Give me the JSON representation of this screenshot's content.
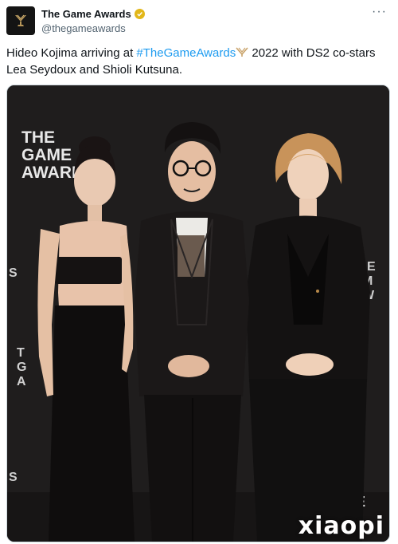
{
  "account": {
    "display_name": "The Game Awards",
    "handle": "@thegameawards",
    "avatar_icon": "trophy-logo-icon",
    "verified_color": "#e2b719"
  },
  "tweet": {
    "text_before": "Hideo Kojima arriving at ",
    "hashtag": "#TheGameAwards",
    "text_after": " 2022 with DS2 co-stars Lea Seydoux and Shioli Kutsuna.",
    "hashtag_emoji_icon": "trophy-hashtag-icon"
  },
  "menu": {
    "more_label": "···"
  },
  "media": {
    "description": "photo",
    "backdrop_text": [
      "THE",
      "GAME",
      "AWARDS"
    ],
    "watermark": "xiaopi"
  },
  "colors": {
    "link": "#1d9bf0",
    "secondary": "#536471",
    "backdrop": "#1e1c1c"
  }
}
